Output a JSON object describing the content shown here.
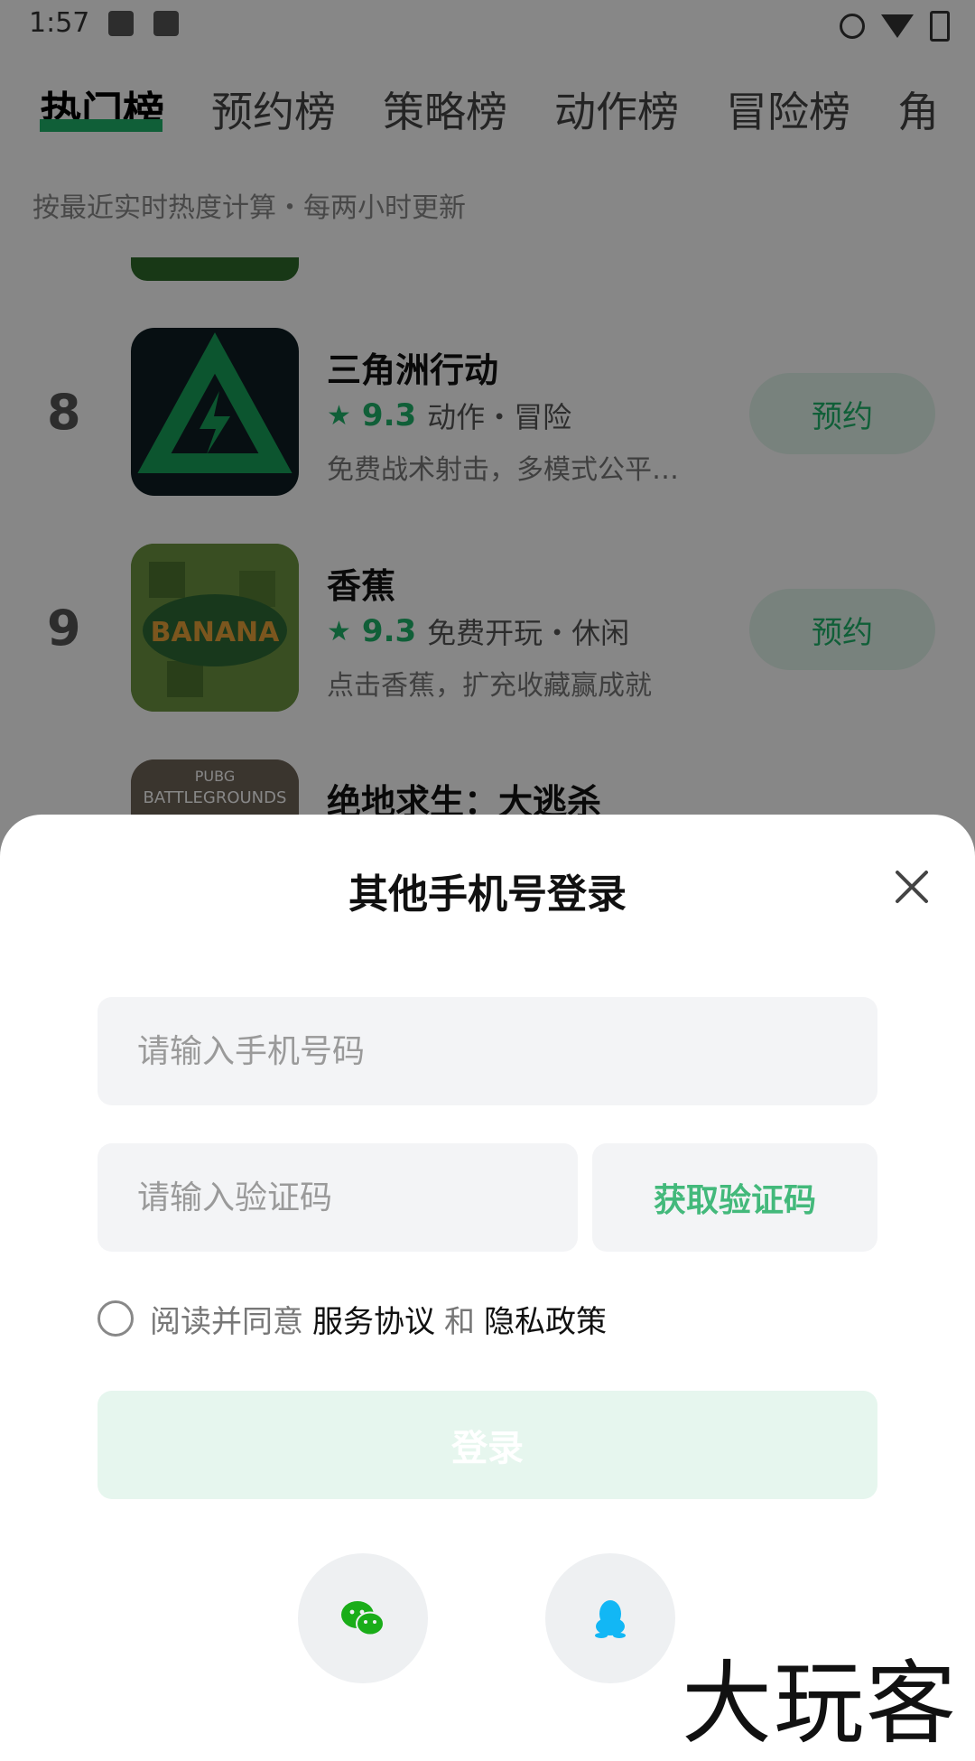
{
  "status_bar": {
    "time": "1:57"
  },
  "tabs": [
    "热门榜",
    "预约榜",
    "策略榜",
    "动作榜",
    "冒险榜",
    "角"
  ],
  "subtitle": "按最近实时热度计算・每两小时更新",
  "games": [
    {
      "rank": "8",
      "name": "三角洲行动",
      "score": "9.3",
      "tags": "动作・冒险",
      "desc": "免费战术射击，多模式公平…",
      "action": "预约"
    },
    {
      "rank": "9",
      "name": "香蕉",
      "score": "9.3",
      "tags": "免费开玩・休闲",
      "desc": "点击香蕉，扩充收藏赢成就",
      "action": "预约"
    },
    {
      "rank": "",
      "name": "绝地求生：大逃杀",
      "score": "",
      "tags": "",
      "desc": "",
      "action": ""
    }
  ],
  "icon_labels": {
    "banana": "BANANA",
    "pubg_top": "PUBG",
    "pubg": "BATTLEGROUNDS"
  },
  "login_sheet": {
    "title": "其他手机号登录",
    "phone_placeholder": "请输入手机号码",
    "code_placeholder": "请输入验证码",
    "get_code": "获取验证码",
    "agree_prefix": "阅读并同意",
    "terms": "服务协议",
    "and": "和",
    "privacy": "隐私政策",
    "login": "登录"
  },
  "social_icons": [
    "wechat-icon",
    "qq-icon"
  ],
  "watermark": "大玩客",
  "colors": {
    "accent": "#1fb36a",
    "login_disabled": "#e6f6ee",
    "input_bg": "#f3f4f6"
  }
}
